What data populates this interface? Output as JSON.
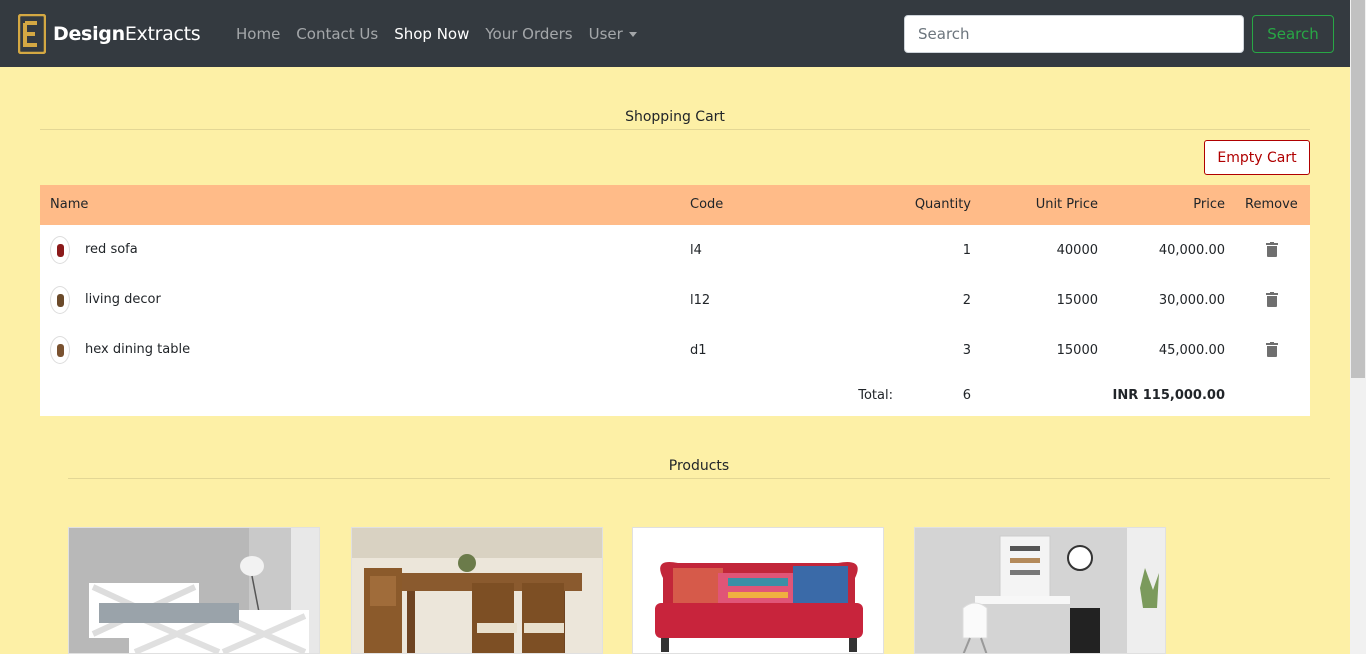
{
  "navbar": {
    "brand_bold": "Design",
    "brand_rest": "Extracts",
    "links": [
      {
        "label": "Home"
      },
      {
        "label": "Contact Us"
      },
      {
        "label": "Shop Now"
      },
      {
        "label": "Your Orders"
      },
      {
        "label": "User"
      }
    ],
    "active_link": "Shop Now",
    "search_placeholder": "Search",
    "search_button": "Search"
  },
  "cart": {
    "heading": "Shopping Cart",
    "empty_button": "Empty Cart",
    "columns": [
      "Name",
      "Code",
      "Quantity",
      "Unit Price",
      "Price",
      "Remove"
    ],
    "rows": [
      {
        "name": "red sofa",
        "code": "l4",
        "quantity": "1",
        "unit_price": "40000",
        "price": "40,000.00"
      },
      {
        "name": "living decor",
        "code": "l12",
        "quantity": "2",
        "unit_price": "15000",
        "price": "30,000.00"
      },
      {
        "name": "hex dining table",
        "code": "d1",
        "quantity": "3",
        "unit_price": "15000",
        "price": "45,000.00"
      }
    ],
    "total_label": "Total:",
    "total_quantity": "6",
    "total_price": "INR 115,000.00"
  },
  "products": {
    "heading": "Products",
    "items": [
      {
        "icon": "bed-image"
      },
      {
        "icon": "dining-set-image"
      },
      {
        "icon": "red-sofa-image"
      },
      {
        "icon": "wall-desk-image"
      }
    ]
  },
  "colors": {
    "page_bg": "#fdf0a6",
    "navbar_bg": "#343a40",
    "table_header": "#ffbb88",
    "search_green": "#28a745",
    "empty_red": "#b00000",
    "logo_gold": "#d4a843"
  }
}
